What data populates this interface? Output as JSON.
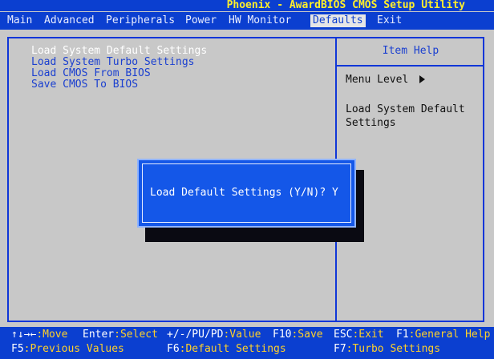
{
  "title": "Phoenix - AwardBIOS CMOS Setup Utility",
  "menu": {
    "main": "Main",
    "advanced": "Advanced",
    "peripherals": "Peripherals",
    "power": "Power",
    "hw_monitor": "HW Monitor",
    "defaults": "Defaults",
    "exit": "Exit"
  },
  "options": [
    "Load System Default Settings",
    "Load System Turbo Settings",
    "Load CMOS From BIOS",
    "Save CMOS To BIOS"
  ],
  "help": {
    "title": "Item Help",
    "menu_level": "Menu Level",
    "text": "Load System Default Settings"
  },
  "dialog": {
    "text": "Load Default Settings (Y/N)? Y"
  },
  "status": {
    "arrows_key": "↑↓→←",
    "arrows_desc": ":Move",
    "enter_key": "Enter",
    "enter_desc": ":Select",
    "value_key": "+/-/PU/PD",
    "value_desc": ":Value",
    "f10_key": "F10",
    "f10_desc": ":Save",
    "esc_key": "ESC",
    "esc_desc": ":Exit",
    "f1_key": "F1",
    "f1_desc": ":General Help",
    "f5_key": "F5",
    "f5_desc": ":Previous Values",
    "f6_key": "F6",
    "f6_desc": ":Default Settings",
    "f7_key": "F7",
    "f7_desc": ":Turbo Settings"
  },
  "colors": {
    "bios_blue": "#0b3fd0",
    "title_yellow": "#ffef2a",
    "panel_gray": "#c8c8c8",
    "dialog_blue": "#1457e8"
  }
}
